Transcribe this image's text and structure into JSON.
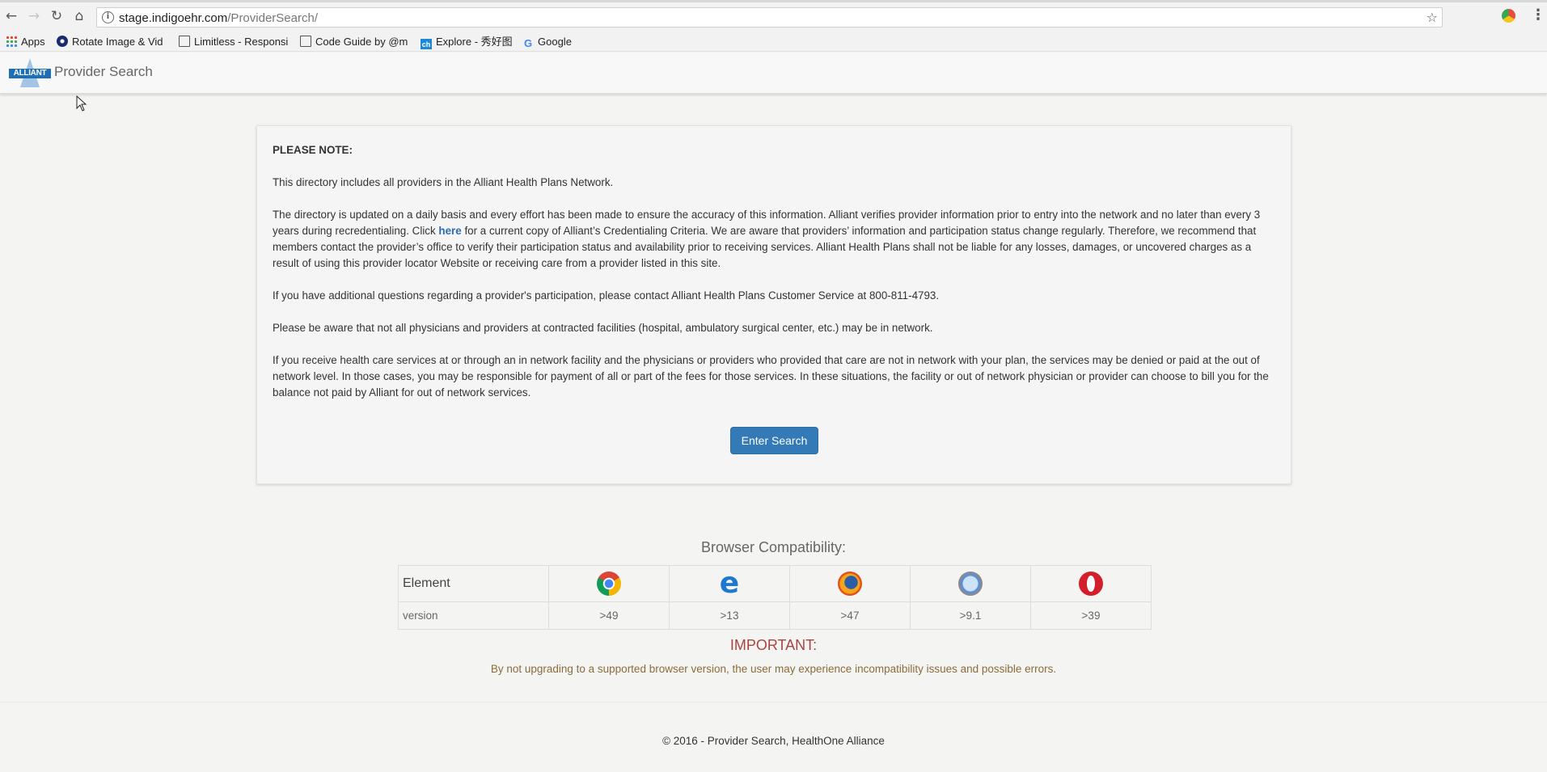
{
  "browser": {
    "url_host": "stage.indigoehr.com",
    "url_path": "/ProviderSearch/",
    "bookmarks": [
      {
        "label": "Apps",
        "icon": "apps-grid-icon"
      },
      {
        "label": "Rotate Image & Vid",
        "icon": "rotate-image-icon"
      },
      {
        "label": "Limitless - Responsi",
        "icon": "page-icon"
      },
      {
        "label": "Code Guide by @m",
        "icon": "page-icon"
      },
      {
        "label": "Explore - 秀好图",
        "icon": "ch-icon"
      },
      {
        "label": "Google",
        "icon": "google-icon"
      }
    ]
  },
  "header": {
    "logo_text": "ALLIANT",
    "title": "Provider Search"
  },
  "notice": {
    "heading": "PLEASE NOTE:",
    "p1": "This directory includes all providers in the Alliant Health Plans Network.",
    "p2_before_link": "The directory is updated on a daily basis and every effort has been made to ensure the accuracy of this information. Alliant verifies provider information prior to entry into the network and no later than every 3 years during recredentialing. Click ",
    "p2_link": "here",
    "p2_after_link": " for a current copy of Alliant’s Credentialing Criteria. We are aware that providers’ information and participation status change regularly. Therefore, we recommend that members contact the provider’s office to verify their participation status and availability prior to receiving services. Alliant Health Plans shall not be liable for any losses, damages, or uncovered charges as a result of using this provider locator Website or receiving care from a provider listed in this site.",
    "p3": "If you have additional questions regarding a provider's participation, please contact Alliant Health Plans Customer Service at 800-811-4793.",
    "p4": "Please be aware that not all physicians and providers at contracted facilities (hospital, ambulatory surgical center, etc.) may be in network.",
    "p5": "If you receive health care services at or through an in network facility and the physicians or providers who provided that care are not in network with your plan, the services may be denied or paid at the out of network level. In those cases, you may be responsible for payment of all or part of the fees for those services. In these situations, the facility or out of network physician or provider can choose to bill you for the balance not paid by Alliant for out of network services.",
    "button_label": "Enter Search"
  },
  "compat": {
    "title": "Browser Compatibility:",
    "row1_label": "Element",
    "row2_label": "version",
    "browsers": [
      {
        "icon": "chrome-icon",
        "version": ">49"
      },
      {
        "icon": "edge-icon",
        "version": ">13"
      },
      {
        "icon": "firefox-icon",
        "version": ">47"
      },
      {
        "icon": "safari-icon",
        "version": ">9.1"
      },
      {
        "icon": "opera-icon",
        "version": ">39"
      }
    ],
    "important_title": "IMPORTANT:",
    "important_text": "By not upgrading to a supported browser version, the user may experience incompatibility issues and possible errors."
  },
  "footer": {
    "text": "© 2016 - Provider Search, HealthOne Alliance"
  },
  "colors": {
    "primary_button": "#337ab7",
    "important": "#a94442",
    "warning_text": "#8a6d3b",
    "link": "#2a6db5"
  }
}
